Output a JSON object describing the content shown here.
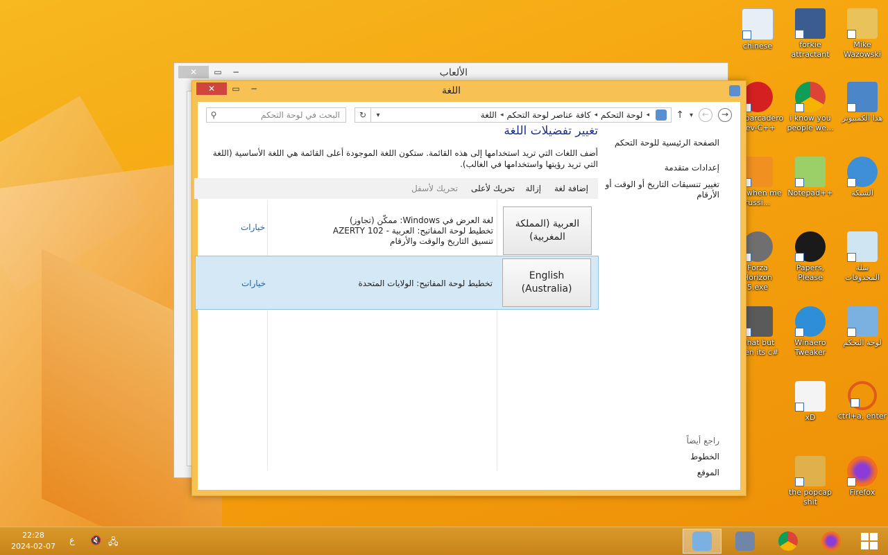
{
  "desktop_icons": [
    {
      "label": "chinese",
      "icon": "document-shortcut-icon"
    },
    {
      "label": "forkie attractant",
      "icon": "computer-settings-icon"
    },
    {
      "label": "Mike Wazowski",
      "icon": "user-folder-icon"
    },
    {
      "label": "Embarcadero Dev-C++",
      "icon": "devcpp-icon"
    },
    {
      "label": "i know you people we...",
      "icon": "chrome-icon"
    },
    {
      "label": "هذا الكمبيوتر",
      "icon": "computer-icon"
    },
    {
      "label": "for when me russi...",
      "icon": "de-app-icon"
    },
    {
      "label": "Notepad++",
      "icon": "notepadpp-icon"
    },
    {
      "label": "الشبكة",
      "icon": "network-icon"
    },
    {
      "label": "Forza Horizon 5.exe",
      "icon": "flash-icon"
    },
    {
      "label": "Papers, Please",
      "icon": "papers-please-icon"
    },
    {
      "label": "سلة المحذوفات",
      "icon": "recycle-bin-icon"
    },
    {
      "label": "what but then its c#",
      "icon": "stacked-windows-icon"
    },
    {
      "label": "Winaero Tweaker",
      "icon": "winaero-icon"
    },
    {
      "label": "لوحة التحكم",
      "icon": "control-panel-icon"
    },
    {
      "label": "xD",
      "icon": "hxd-icon"
    },
    {
      "label": "ctrl+a, enter",
      "icon": "search-shortcut-icon"
    },
    {
      "label": "the popcap shit",
      "icon": "folder-icon"
    },
    {
      "label": "Firefox",
      "icon": "firefox-icon"
    }
  ],
  "back_window": {
    "title": "الألعاب"
  },
  "window": {
    "title": "اللغة",
    "search_placeholder": "البحث في لوحة التحكم",
    "breadcrumbs": [
      "لوحة التحكم",
      "كافة عناصر لوحة التحكم",
      "اللغة"
    ],
    "side": {
      "home": "الصفحة الرئيسية للوحة التحكم",
      "advanced": "إعدادات متقدمة",
      "change_formats": "تغيير تنسيقات التاريخ أو الوقت أو الأرقام",
      "see_also": "راجع أيضاً",
      "fonts": "الخطوط",
      "location": "الموقع"
    },
    "page_title": "تغيير تفضيلات اللغة",
    "description": "أضف اللغات التي تريد استخدامها إلى هذه القائمة. ستكون اللغة الموجودة أعلى القائمة هي اللغة الأساسية (اللغة التي تريد رؤيتها واستخدامها في الغالب).",
    "toolbar": {
      "add": "إضافة لغة",
      "remove": "إزالة",
      "move_up": "تحريك لأعلى",
      "move_down": "تحريك لأسفل"
    },
    "languages": [
      {
        "name": "العربية (المملكة المغربية)",
        "details": [
          "لغة العرض في Windows: ممكّن (تجاوز)",
          "تخطيط لوحة المفاتيح: العربية - 102 AZERTY",
          "تنسيق التاريخ والوقت والأرقام"
        ],
        "options": "خيارات",
        "selected": false
      },
      {
        "name": "English (Australia)",
        "details": [
          "تخطيط لوحة المفاتيح: الولايات المتحدة"
        ],
        "options": "خيارات",
        "selected": true
      }
    ]
  },
  "taskbar": {
    "time": "22:28",
    "date": "2024-02-07",
    "ime": "ع"
  }
}
